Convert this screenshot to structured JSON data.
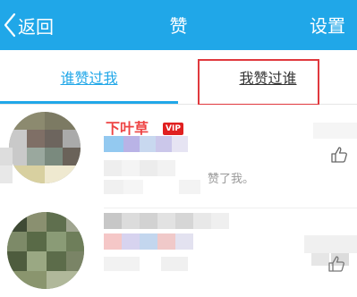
{
  "header": {
    "back_label": "返回",
    "title": "赞",
    "settings_label": "设置"
  },
  "tabs": [
    {
      "label": "谁赞过我",
      "active": true
    },
    {
      "label": "我赞过谁",
      "active": false
    }
  ],
  "list": {
    "items": [
      {
        "name": "下叶草",
        "badge": "VIP",
        "message": "赞了我。"
      },
      {
        "name": "",
        "badge": "",
        "message": ""
      }
    ]
  },
  "colors": {
    "accent": "#20a7e8",
    "highlight_box": "#e0393e"
  }
}
